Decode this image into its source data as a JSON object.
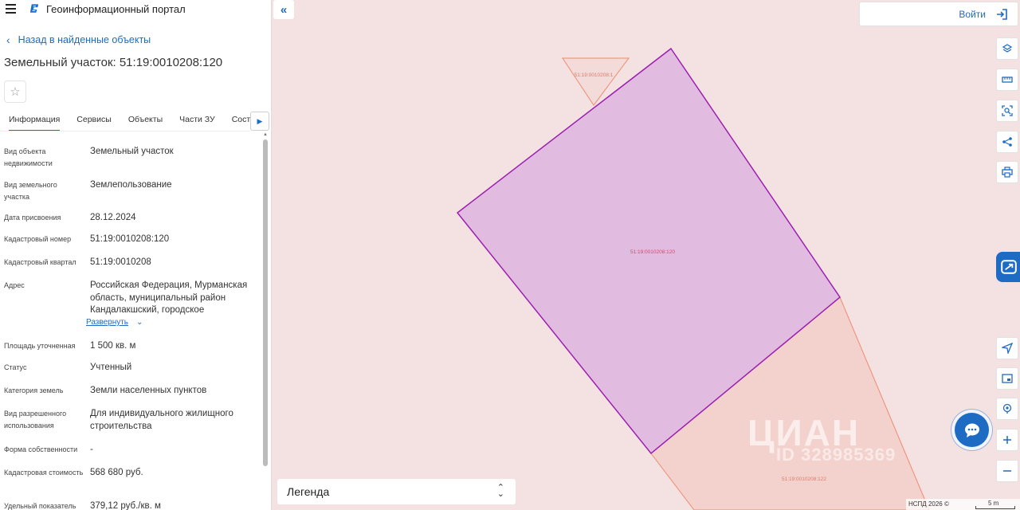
{
  "app": {
    "title": "Геоинформационный портал"
  },
  "nav": {
    "back_label": "Назад в найденные объекты"
  },
  "object": {
    "title": "Земельный участок: 51:19:0010208:120"
  },
  "tabs": [
    {
      "label": "Информация",
      "active": true
    },
    {
      "label": "Сервисы"
    },
    {
      "label": "Объекты"
    },
    {
      "label": "Части ЗУ"
    },
    {
      "label": "Состав"
    }
  ],
  "properties": [
    {
      "label": "Вид объекта недвижимости",
      "value": "Земельный участок"
    },
    {
      "label": "Вид земельного участка",
      "value": "Землепользование"
    },
    {
      "label": "Дата присвоения",
      "value": "28.12.2024"
    },
    {
      "label": "Кадастровый номер",
      "value": "51:19:0010208:120"
    },
    {
      "label": "Кадастровый квартал",
      "value": "51:19:0010208"
    },
    {
      "label": "Адрес",
      "value": "Российская Федерация, Мурманская область, муниципальный район Кандалакшский, городское"
    },
    {
      "label": "Площадь уточненная",
      "value": "1 500 кв. м"
    },
    {
      "label": "Статус",
      "value": "Учтенный"
    },
    {
      "label": "Категория земель",
      "value": "Земли населенных пунктов"
    },
    {
      "label": "Вид разрешенного использования",
      "value": "Для индивидуального жилищного строительства"
    },
    {
      "label": "Форма собственности",
      "value": "-"
    },
    {
      "label": "Кадастровая стоимость",
      "value": "568 680 руб."
    },
    {
      "label": "Удельный показатель",
      "value": "379,12 руб./кв. м"
    }
  ],
  "expand_label": "Развернуть",
  "map": {
    "parcels": [
      {
        "id": "51:19:0010208:120",
        "selected": true,
        "color": "#9c1fb0"
      },
      {
        "id": "51:19:0010208:122",
        "selected": false,
        "color": "#f08a6e"
      },
      {
        "id": "51:19:0010208:1",
        "selected": false,
        "color": "#f08a6e"
      }
    ],
    "watermark": "ЦИАН",
    "watermark_id": "ID 328985369",
    "attribution": "НСПД 2026 ©",
    "scale_label": "5 m"
  },
  "login_label": "Войти",
  "legend_label": "Легенда",
  "colors": {
    "accent": "#1e6bc4",
    "map_bg": "#f4e2e3"
  },
  "icons": {
    "tools": [
      "layers-icon",
      "ruler-icon",
      "select-area-icon",
      "share-icon",
      "print-icon"
    ],
    "nav_tools": [
      "locate-icon",
      "minimap-icon",
      "pin-icon",
      "zoom-in-icon",
      "zoom-out-icon"
    ],
    "chat": "chat-icon",
    "side_tab": "reports-icon"
  }
}
